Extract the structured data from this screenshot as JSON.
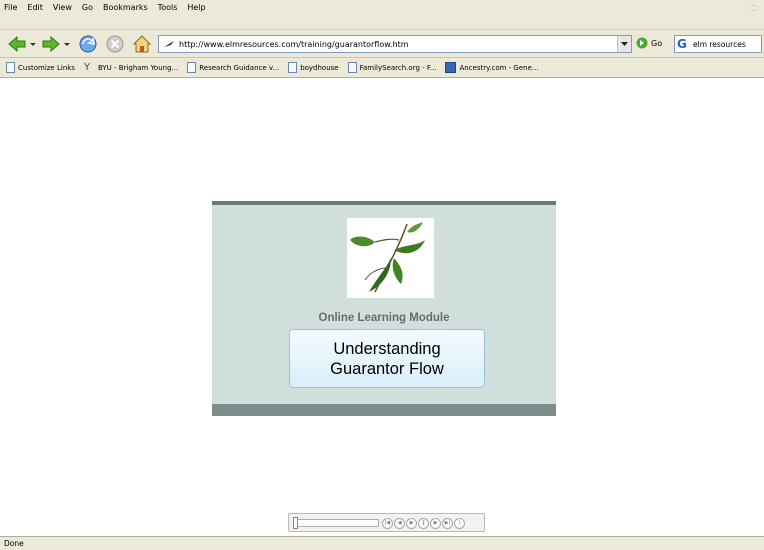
{
  "menu": {
    "items": [
      "File",
      "Edit",
      "View",
      "Go",
      "Bookmarks",
      "Tools",
      "Help"
    ]
  },
  "nav": {
    "url": "http://www.elmresources.com/training/guarantorflow.htm",
    "go_label": "Go",
    "search_value": "elm resources"
  },
  "bookmarks": [
    {
      "label": "Customize Links",
      "icon": "page-icon"
    },
    {
      "label": "BYU - Brigham Young...",
      "icon": "y-icon"
    },
    {
      "label": "Research Guidance v...",
      "icon": "page-icon"
    },
    {
      "label": "boydhouse",
      "icon": "page-icon"
    },
    {
      "label": "FamilySearch.org - F...",
      "icon": "page-icon"
    },
    {
      "label": "Ancestry.com - Gene...",
      "icon": "ancestry-icon"
    }
  ],
  "module": {
    "subtitle": "Online Learning Module",
    "title_line1": "Understanding",
    "title_line2": "Guarantor Flow"
  },
  "status": {
    "text": "Done"
  },
  "colors": {
    "panel": "#d2e0dd",
    "panel_border": "#6c7b7a",
    "title_box": "#d9eef9"
  }
}
